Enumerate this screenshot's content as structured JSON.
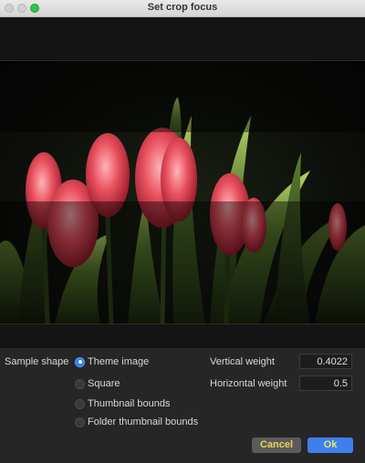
{
  "window": {
    "title": "Set crop focus"
  },
  "form": {
    "sample_shape_label": "Sample shape",
    "options": [
      {
        "label": "Theme image",
        "selected": true
      },
      {
        "label": "Square",
        "selected": false
      },
      {
        "label": "Thumbnail bounds",
        "selected": false
      },
      {
        "label": "Folder thumbnail bounds",
        "selected": false
      }
    ],
    "vertical_weight_label": "Vertical weight",
    "vertical_weight_value": "0.4022",
    "horizontal_weight_label": "Horizontal weight",
    "horizontal_weight_value": "0.5"
  },
  "buttons": {
    "cancel_label": "Cancel",
    "ok_label": "Ok"
  },
  "colors": {
    "accent": "#3e7ff0",
    "button_text": "#e5d650",
    "background": "#262626"
  }
}
